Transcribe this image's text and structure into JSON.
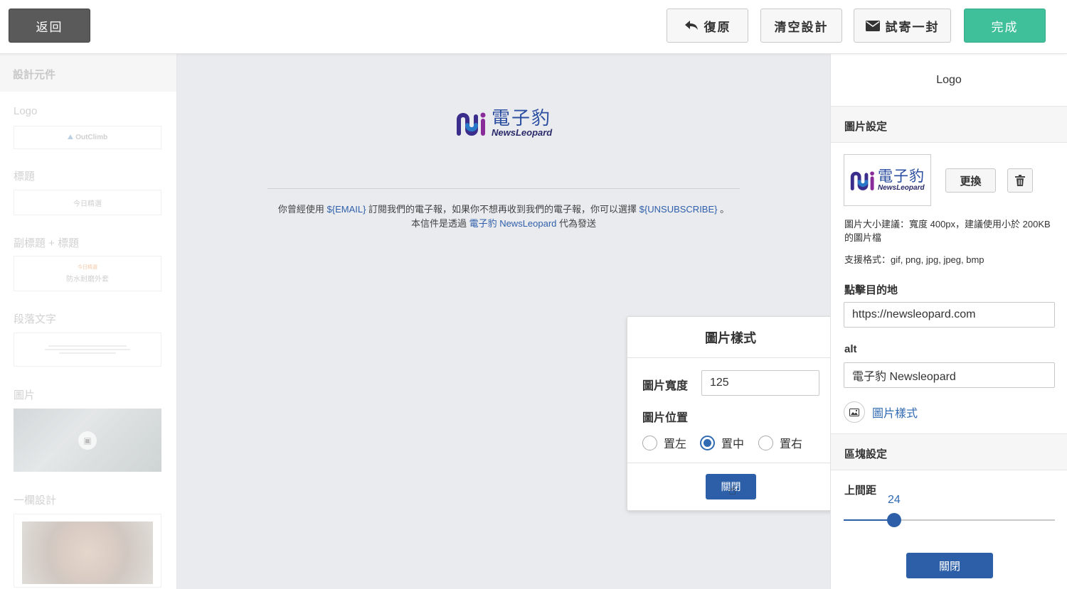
{
  "toolbar": {
    "back_label": "返回",
    "undo_label": "復原",
    "clear_label": "清空設計",
    "test_send_label": "試寄一封",
    "done_label": "完成"
  },
  "sidebar": {
    "header": "設計元件",
    "items": [
      {
        "label": "Logo",
        "preview": "OutClimb"
      },
      {
        "label": "標題",
        "preview": "今日精選"
      },
      {
        "label": "副標題 + 標題",
        "preview_sub": "今日精選",
        "preview": "防水耐磨外套"
      },
      {
        "label": "段落文字"
      },
      {
        "label": "圖片"
      },
      {
        "label": "一欄設計"
      }
    ]
  },
  "canvas": {
    "logo": {
      "text_top": "電子豹",
      "text_bottom": "NewsLeopard"
    },
    "footer": {
      "line1_a": "你曾經使用 ",
      "line1_email": "${EMAIL}",
      "line1_b": " 訂閱我們的電子報，如果你不想再收到我們的電子報，你可以選擇 ",
      "line1_unsub": "${UNSUBSCRIBE}",
      "line1_c": " 。",
      "line2_a": "本信件是透過 ",
      "line2_link": "電子豹 NewsLeopard",
      "line2_b": " 代為發送"
    }
  },
  "popup": {
    "title": "圖片樣式",
    "width_label": "圖片寬度",
    "width_value": "125",
    "position_label": "圖片位置",
    "options": [
      {
        "label": "置左",
        "selected": false
      },
      {
        "label": "置中",
        "selected": true
      },
      {
        "label": "置右",
        "selected": false
      }
    ],
    "close_label": "關閉"
  },
  "right_panel": {
    "title": "Logo",
    "image_settings_header": "圖片設定",
    "replace_label": "更換",
    "size_hint": "圖片大小建議：寬度 400px，建議使用小於 200KB 的圖片檔",
    "formats_hint": "支援格式：gif, png, jpg, jpeg, bmp",
    "link_label": "點擊目的地",
    "link_value": "https://newsleopard.com",
    "alt_label": "alt",
    "alt_value": "電子豹 Newsleopard",
    "image_style_link": "圖片樣式",
    "block_settings_header": "區塊設定",
    "top_spacing_label": "上間距",
    "top_spacing_value": "24",
    "top_spacing_fraction": 0.24,
    "close_label": "關閉"
  },
  "colors": {
    "accent_blue": "#2c5fa8",
    "done_green": "#3fbf9a",
    "canvas_bg": "#eaebef",
    "link_blue": "#2f5faa"
  }
}
